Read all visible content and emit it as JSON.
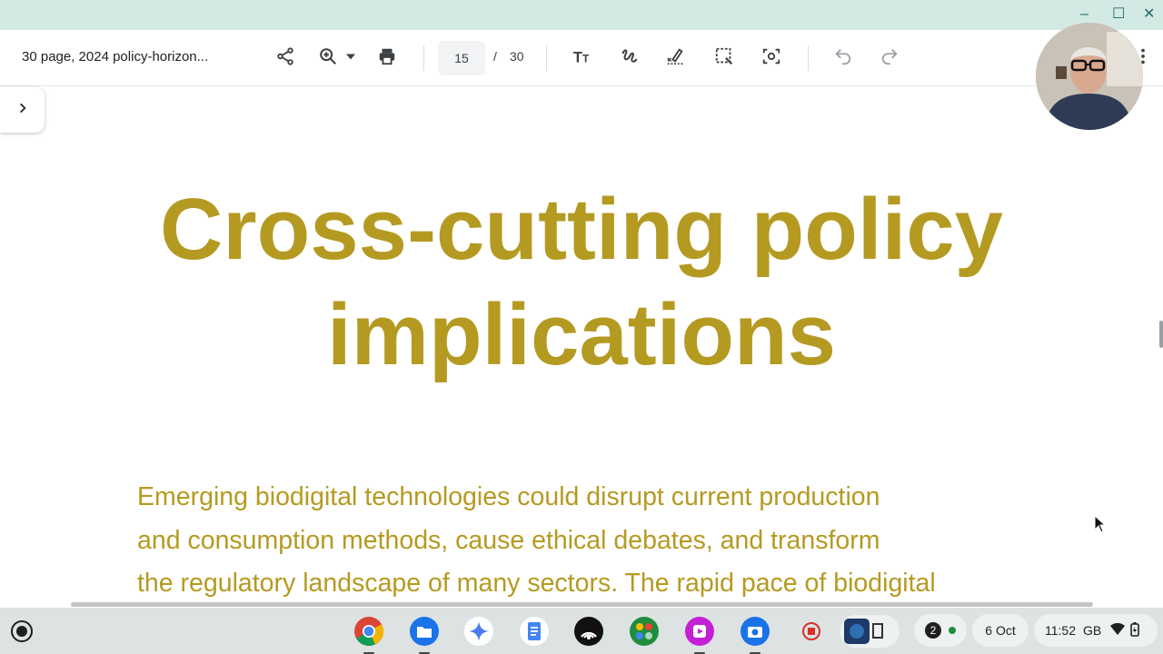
{
  "window": {
    "minimize": "–",
    "maximize": "☐",
    "close": "✕"
  },
  "toolbar": {
    "doc_title": "30 page, 2024 policy-horizon...",
    "current_page": "15",
    "page_separator": "/",
    "total_pages": "30",
    "icons": [
      "share-icon",
      "zoom-in-icon",
      "dropdown-arrow-icon",
      "print-icon",
      "text-icon",
      "draw-icon",
      "signature-icon",
      "select-area-icon",
      "screenshot-lens-icon",
      "undo-icon",
      "redo-icon"
    ]
  },
  "document": {
    "heading_line1": "Cross-cutting policy",
    "heading_line2": "implications",
    "para_line1": "Emerging biodigital technologies could disrupt current production",
    "para_line2": "and consumption methods, cause ethical debates, and transform",
    "para_line3": "the regulatory landscape of many sectors. The rapid pace of biodigital",
    "accent_color": "#b59a22"
  },
  "shelf": {
    "apps": [
      "chrome-icon",
      "files-icon",
      "gemini-icon",
      "docs-icon",
      "podcast-icon",
      "app-grid-icon",
      "screencast-icon",
      "camera-icon",
      "record-icon",
      "pinned-app-icon"
    ],
    "notification_count": "2",
    "date": "6 Oct",
    "time": "11:52",
    "locale": "GB"
  }
}
